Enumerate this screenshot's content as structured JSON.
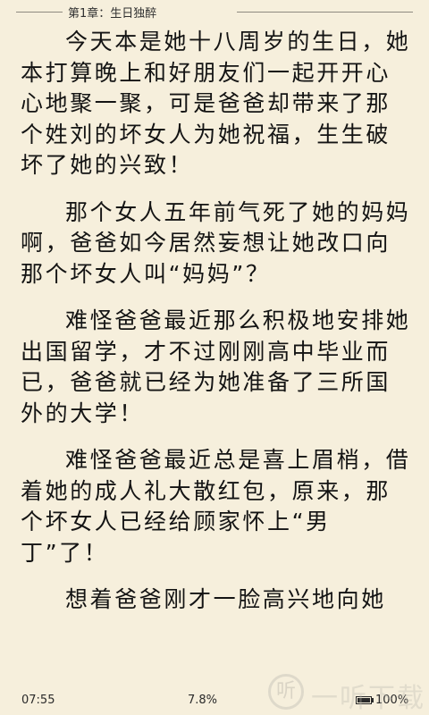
{
  "header": {
    "chapter_title": "第1章：生日独醉"
  },
  "content": {
    "paragraphs": [
      "今天本是她十八周岁的生日，她本打算晚上和好朋友们一起开开心心地聚一聚，可是爸爸却带来了那个姓刘的坏女人为她祝福，生生破坏了她的兴致！",
      "那个女人五年前气死了她的妈妈啊，爸爸如今居然妄想让她改口向那个坏女人叫“妈妈”？",
      "难怪爸爸最近那么积极地安排她出国留学，才不过刚刚高中毕业而已，爸爸就已经为她准备了三所国外的大学！",
      "难怪爸爸最近总是喜上眉梢，借着她的成人礼大散红包，原来，那个坏女人已经给顾家怀上“男丁”了！",
      "想着爸爸刚才一脸高兴地向她"
    ]
  },
  "footer": {
    "time": "07:55",
    "progress": "7.8%",
    "battery_percent": "100%",
    "battery_level": 1.0
  },
  "watermark": {
    "logo_glyph": "听",
    "text": "一听下载"
  }
}
